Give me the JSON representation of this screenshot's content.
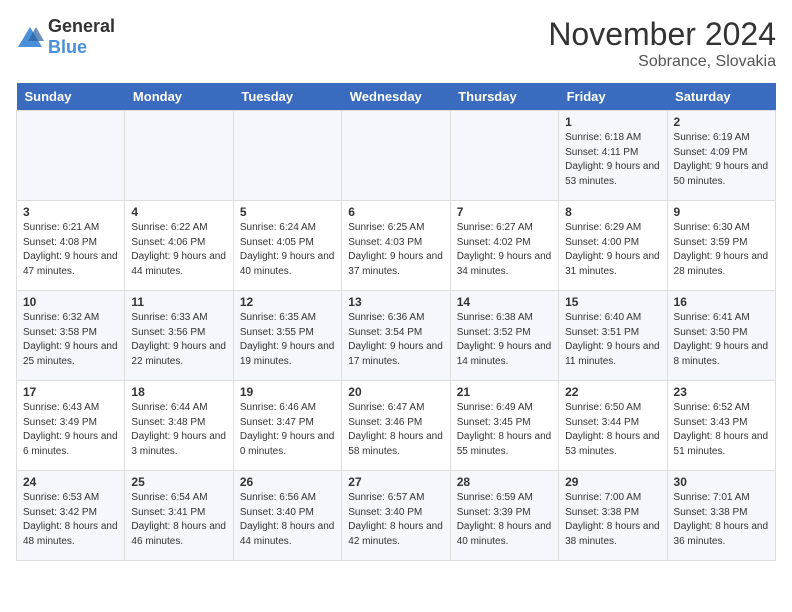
{
  "header": {
    "logo_general": "General",
    "logo_blue": "Blue",
    "title": "November 2024",
    "subtitle": "Sobrance, Slovakia"
  },
  "weekdays": [
    "Sunday",
    "Monday",
    "Tuesday",
    "Wednesday",
    "Thursday",
    "Friday",
    "Saturday"
  ],
  "weeks": [
    [
      {
        "day": "",
        "info": ""
      },
      {
        "day": "",
        "info": ""
      },
      {
        "day": "",
        "info": ""
      },
      {
        "day": "",
        "info": ""
      },
      {
        "day": "",
        "info": ""
      },
      {
        "day": "1",
        "info": "Sunrise: 6:18 AM\nSunset: 4:11 PM\nDaylight: 9 hours and 53 minutes."
      },
      {
        "day": "2",
        "info": "Sunrise: 6:19 AM\nSunset: 4:09 PM\nDaylight: 9 hours and 50 minutes."
      }
    ],
    [
      {
        "day": "3",
        "info": "Sunrise: 6:21 AM\nSunset: 4:08 PM\nDaylight: 9 hours and 47 minutes."
      },
      {
        "day": "4",
        "info": "Sunrise: 6:22 AM\nSunset: 4:06 PM\nDaylight: 9 hours and 44 minutes."
      },
      {
        "day": "5",
        "info": "Sunrise: 6:24 AM\nSunset: 4:05 PM\nDaylight: 9 hours and 40 minutes."
      },
      {
        "day": "6",
        "info": "Sunrise: 6:25 AM\nSunset: 4:03 PM\nDaylight: 9 hours and 37 minutes."
      },
      {
        "day": "7",
        "info": "Sunrise: 6:27 AM\nSunset: 4:02 PM\nDaylight: 9 hours and 34 minutes."
      },
      {
        "day": "8",
        "info": "Sunrise: 6:29 AM\nSunset: 4:00 PM\nDaylight: 9 hours and 31 minutes."
      },
      {
        "day": "9",
        "info": "Sunrise: 6:30 AM\nSunset: 3:59 PM\nDaylight: 9 hours and 28 minutes."
      }
    ],
    [
      {
        "day": "10",
        "info": "Sunrise: 6:32 AM\nSunset: 3:58 PM\nDaylight: 9 hours and 25 minutes."
      },
      {
        "day": "11",
        "info": "Sunrise: 6:33 AM\nSunset: 3:56 PM\nDaylight: 9 hours and 22 minutes."
      },
      {
        "day": "12",
        "info": "Sunrise: 6:35 AM\nSunset: 3:55 PM\nDaylight: 9 hours and 19 minutes."
      },
      {
        "day": "13",
        "info": "Sunrise: 6:36 AM\nSunset: 3:54 PM\nDaylight: 9 hours and 17 minutes."
      },
      {
        "day": "14",
        "info": "Sunrise: 6:38 AM\nSunset: 3:52 PM\nDaylight: 9 hours and 14 minutes."
      },
      {
        "day": "15",
        "info": "Sunrise: 6:40 AM\nSunset: 3:51 PM\nDaylight: 9 hours and 11 minutes."
      },
      {
        "day": "16",
        "info": "Sunrise: 6:41 AM\nSunset: 3:50 PM\nDaylight: 9 hours and 8 minutes."
      }
    ],
    [
      {
        "day": "17",
        "info": "Sunrise: 6:43 AM\nSunset: 3:49 PM\nDaylight: 9 hours and 6 minutes."
      },
      {
        "day": "18",
        "info": "Sunrise: 6:44 AM\nSunset: 3:48 PM\nDaylight: 9 hours and 3 minutes."
      },
      {
        "day": "19",
        "info": "Sunrise: 6:46 AM\nSunset: 3:47 PM\nDaylight: 9 hours and 0 minutes."
      },
      {
        "day": "20",
        "info": "Sunrise: 6:47 AM\nSunset: 3:46 PM\nDaylight: 8 hours and 58 minutes."
      },
      {
        "day": "21",
        "info": "Sunrise: 6:49 AM\nSunset: 3:45 PM\nDaylight: 8 hours and 55 minutes."
      },
      {
        "day": "22",
        "info": "Sunrise: 6:50 AM\nSunset: 3:44 PM\nDaylight: 8 hours and 53 minutes."
      },
      {
        "day": "23",
        "info": "Sunrise: 6:52 AM\nSunset: 3:43 PM\nDaylight: 8 hours and 51 minutes."
      }
    ],
    [
      {
        "day": "24",
        "info": "Sunrise: 6:53 AM\nSunset: 3:42 PM\nDaylight: 8 hours and 48 minutes."
      },
      {
        "day": "25",
        "info": "Sunrise: 6:54 AM\nSunset: 3:41 PM\nDaylight: 8 hours and 46 minutes."
      },
      {
        "day": "26",
        "info": "Sunrise: 6:56 AM\nSunset: 3:40 PM\nDaylight: 8 hours and 44 minutes."
      },
      {
        "day": "27",
        "info": "Sunrise: 6:57 AM\nSunset: 3:40 PM\nDaylight: 8 hours and 42 minutes."
      },
      {
        "day": "28",
        "info": "Sunrise: 6:59 AM\nSunset: 3:39 PM\nDaylight: 8 hours and 40 minutes."
      },
      {
        "day": "29",
        "info": "Sunrise: 7:00 AM\nSunset: 3:38 PM\nDaylight: 8 hours and 38 minutes."
      },
      {
        "day": "30",
        "info": "Sunrise: 7:01 AM\nSunset: 3:38 PM\nDaylight: 8 hours and 36 minutes."
      }
    ]
  ]
}
